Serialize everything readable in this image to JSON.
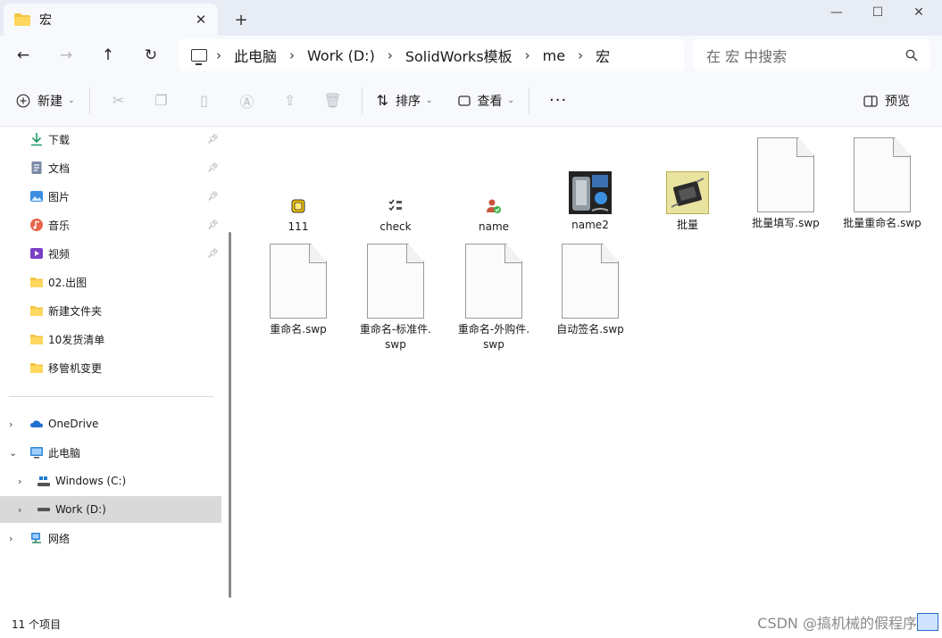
{
  "tab": {
    "title": "宏",
    "close": "✕",
    "new_tab": "+"
  },
  "window_controls": {
    "minimize": "—",
    "maximize": "☐",
    "close": "✕"
  },
  "address": {
    "crumbs": [
      "此电脑",
      "Work (D:)",
      "SolidWorks模板",
      "me",
      "宏"
    ],
    "separator": "›"
  },
  "search": {
    "placeholder": "在 宏 中搜索"
  },
  "commands": {
    "new": "新建",
    "sort": "排序",
    "view": "查看",
    "more": "···",
    "preview": "预览"
  },
  "sidebar": {
    "quick_access": [
      {
        "label": "下载",
        "icon": "download-icon"
      },
      {
        "label": "文档",
        "icon": "document-icon"
      },
      {
        "label": "图片",
        "icon": "pictures-icon"
      },
      {
        "label": "音乐",
        "icon": "music-icon"
      },
      {
        "label": "视频",
        "icon": "video-icon"
      },
      {
        "label": "02.出图",
        "icon": "folder-icon"
      },
      {
        "label": "新建文件夹",
        "icon": "folder-icon"
      },
      {
        "label": "10发货清单",
        "icon": "folder-icon"
      },
      {
        "label": "移管机变更",
        "icon": "folder-icon"
      }
    ],
    "tree": [
      {
        "label": "OneDrive",
        "icon": "cloud-icon"
      },
      {
        "label": "此电脑",
        "icon": "computer-icon"
      },
      {
        "label": "Windows (C:)",
        "icon": "drive-icon"
      },
      {
        "label": "Work (D:)",
        "icon": "drive-icon"
      },
      {
        "label": "网络",
        "icon": "network-icon"
      }
    ]
  },
  "files": [
    {
      "name": "111",
      "icon": "macro-folder-icon"
    },
    {
      "name": "check",
      "icon": "checklist-icon"
    },
    {
      "name": "name",
      "icon": "user-check-icon"
    },
    {
      "name": "name2",
      "icon": "media-icon"
    },
    {
      "name": "批量",
      "icon": "chip-icon"
    },
    {
      "name": "批量填写.swp",
      "icon": "blank-file-icon"
    },
    {
      "name": "批量重命名.swp",
      "icon": "blank-file-icon"
    },
    {
      "name": "重命名.swp",
      "icon": "blank-file-icon"
    },
    {
      "name_line1": "重命名-标准件.",
      "name_line2": "swp",
      "icon": "blank-file-icon"
    },
    {
      "name_line1": "重命名-外购件.",
      "name_line2": "swp",
      "icon": "blank-file-icon"
    },
    {
      "name": "自动签名.swp",
      "icon": "blank-file-icon"
    }
  ],
  "status": {
    "count": "11 个项目"
  },
  "watermark": "CSDN @搞机械的假程序猿"
}
